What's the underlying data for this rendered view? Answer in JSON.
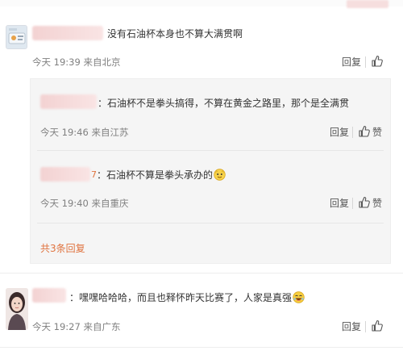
{
  "comments": [
    {
      "text": "没有石油杯本身也不算大满贯啊",
      "meta": "今天 19:39 来自北京",
      "reply_label": "回复"
    },
    {
      "text": "嘿嘿哈哈哈，而且也释怀昨天比赛了，人家是真强",
      "meta": "今天 19:27 来自广东",
      "reply_label": "回复"
    }
  ],
  "replies": [
    {
      "text": "：石油杯不是拳头搞得，不算在黄金之路里，那个是全满贯",
      "meta": "今天 19:46 来自江苏",
      "reply_label": "回复",
      "like_label": "赞"
    },
    {
      "name_tail": "7",
      "text": "：石油杯不算是拳头承办的",
      "meta": "今天 19:40 来自重庆",
      "reply_label": "回复",
      "like_label": "赞"
    }
  ],
  "more_replies_label": "共3条回复",
  "colors": {
    "link_orange": "#e0733f",
    "reply_bg": "#f5f5f5",
    "meta_gray": "#808080"
  },
  "icons": [
    "thumbs-up-icon",
    "laughing-emoji-icon",
    "cool-emoji-icon"
  ]
}
